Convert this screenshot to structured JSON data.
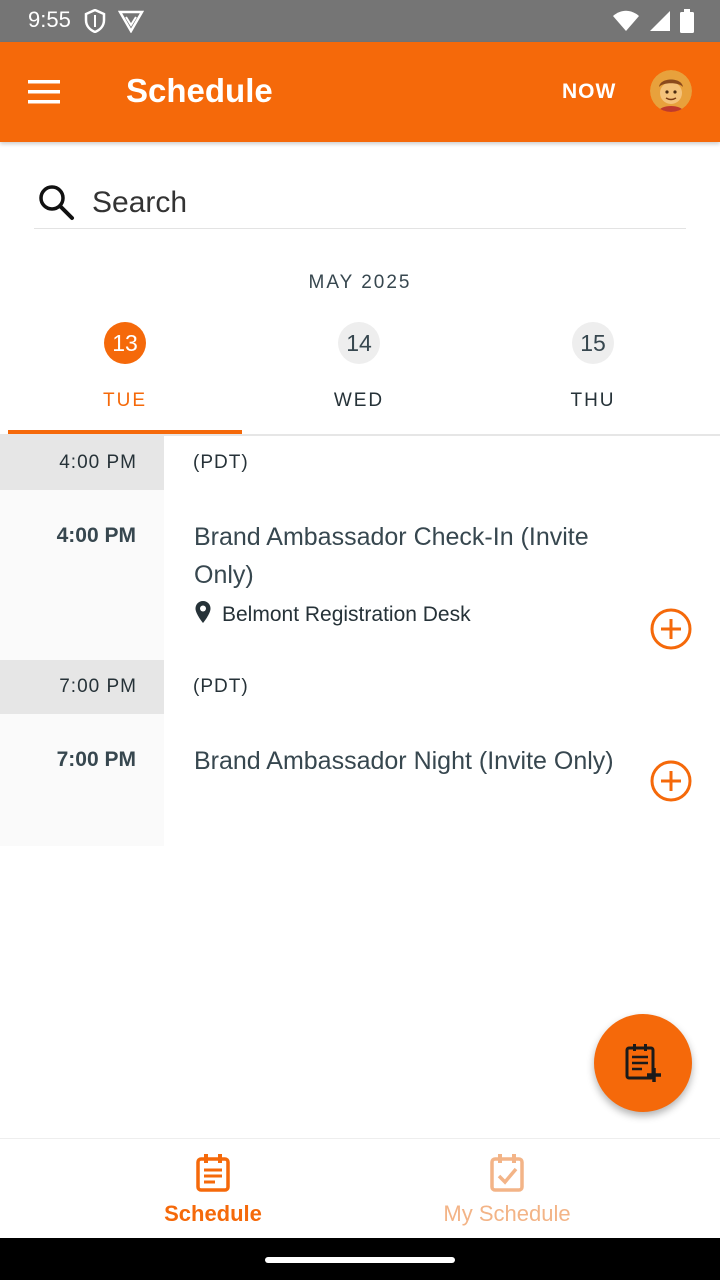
{
  "status_bar": {
    "time": "9:55",
    "left_icons": [
      "shield-icon",
      "vpn-icon"
    ],
    "right_icons": [
      "wifi-icon",
      "signal-icon",
      "battery-icon"
    ]
  },
  "app_bar": {
    "menu_icon": "menu-icon",
    "title": "Schedule",
    "now_label": "NOW",
    "avatar_icon": "avatar"
  },
  "search": {
    "placeholder": "Search",
    "icon": "search-icon"
  },
  "calendar": {
    "month": "MAY 2025",
    "days": [
      {
        "num": "13",
        "name": "TUE",
        "active": true
      },
      {
        "num": "14",
        "name": "WED",
        "active": false
      },
      {
        "num": "15",
        "name": "THU",
        "active": false
      }
    ]
  },
  "schedule": {
    "groups": [
      {
        "time": "4:00 PM",
        "timezone": "(PDT)",
        "sessions": [
          {
            "time": "4:00 PM",
            "title": "Brand Ambassador Check-In (Invite Only)",
            "location": "Belmont Registration Desk"
          }
        ]
      },
      {
        "time": "7:00 PM",
        "timezone": "(PDT)",
        "sessions": [
          {
            "time": "7:00 PM",
            "title": "Brand Ambassador Night (Invite Only)",
            "location": ""
          }
        ]
      }
    ]
  },
  "fab": {
    "icon": "add-note-icon"
  },
  "bottom_nav": {
    "items": [
      {
        "label": "Schedule",
        "icon": "schedule-icon",
        "active": true
      },
      {
        "label": "My Schedule",
        "icon": "my-schedule-icon",
        "active": false
      }
    ]
  },
  "colors": {
    "accent": "#f5690a",
    "accent_light": "#f3b487",
    "status_bar": "#757575",
    "text": "#37474f"
  }
}
